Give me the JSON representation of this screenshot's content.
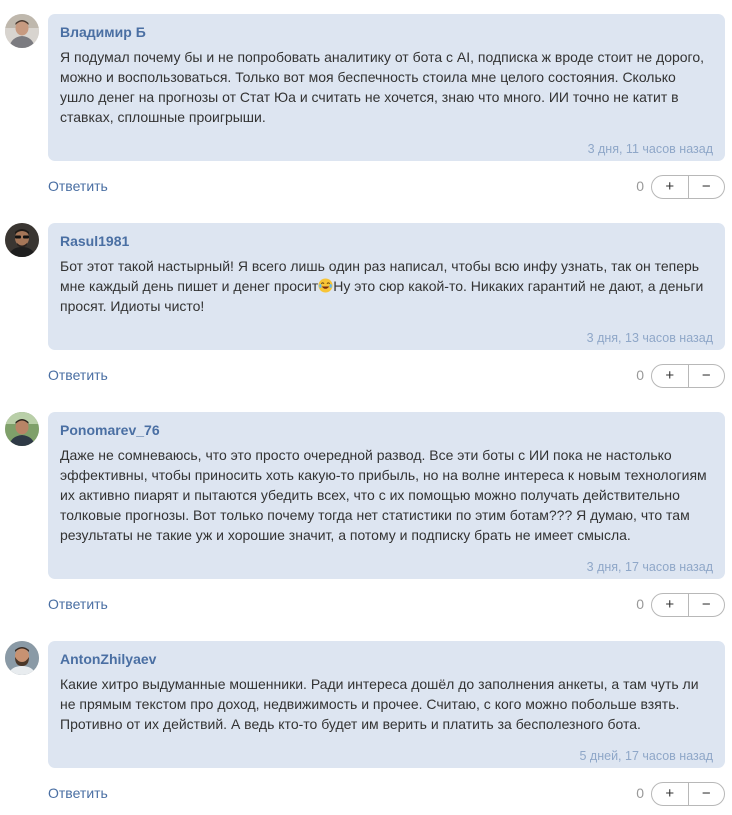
{
  "comments": [
    {
      "author": "Владимир Б",
      "avatar": "avatar-gray-shirt",
      "lines": [
        "Я подумал почему бы и не попробовать аналитику от бота с AI, подписка ж вроде стоит не дорого,",
        "можно и воспользоваться. Только вот моя беспечность стоила мне целого состояния. Сколько",
        "ушло денег на прогнозы от Стат Юа и считать не хочется, знаю что много. ИИ точно не катит в",
        "ставках, сплошные проигрыши."
      ],
      "time": "3 дня, 11 часов назад",
      "reply_label": "Ответить",
      "score": "0",
      "plus": "+",
      "minus": "−"
    },
    {
      "author": "Rasul1981",
      "avatar": "avatar-dark-sunglasses",
      "line1": "Бот этот такой настырный! Я всего лишь один раз написал, чтобы всю инфу узнать, так он теперь",
      "line2_before": "мне каждый день пишет и денег просит",
      "emoji": "laughing-face-emoji",
      "line2_after": "Ну это сюр какой-то. Никаких гарантий не дают, а деньги",
      "line3": "просят. Идиоты чисто!",
      "time": "3 дня, 13 часов назад",
      "reply_label": "Ответить",
      "score": "0",
      "plus": "+",
      "minus": "−"
    },
    {
      "author": "Ponomarev_76",
      "avatar": "avatar-outdoor-man",
      "lines": [
        "Даже не сомневаюсь, что это просто очередной развод. Все эти боты с ИИ пока не настолько",
        "эффективны, чтобы приносить хоть какую-то прибыль, но на волне интереса к новым технологиям",
        "их активно пиарят и пытаются убедить всех, что с их помощью можно получать действительно",
        "толковые прогнозы. Вот только почему тогда нет статистики по этим ботам??? Я думаю, что там",
        "результаты не такие уж и хорошие значит, а потому и подписку брать не имеет смысла."
      ],
      "time": "3 дня, 17 часов назад",
      "reply_label": "Ответить",
      "score": "0",
      "plus": "+",
      "minus": "−"
    },
    {
      "author": "AntonZhilyaev",
      "avatar": "avatar-bearded-man",
      "lines": [
        "Какие хитро выдуманные мошенники. Ради интереса дошёл до заполнения анкеты, а там чуть ли",
        "не прямым текстом про доход, недвижимость и прочее. Считаю, с кого можно побольше взять.",
        "Противно от их действий. А ведь кто-то будет им верить и платить за бесполезного бота."
      ],
      "time": "5 дней, 17 часов назад",
      "reply_label": "Ответить",
      "score": "0",
      "plus": "+",
      "minus": "−"
    }
  ]
}
